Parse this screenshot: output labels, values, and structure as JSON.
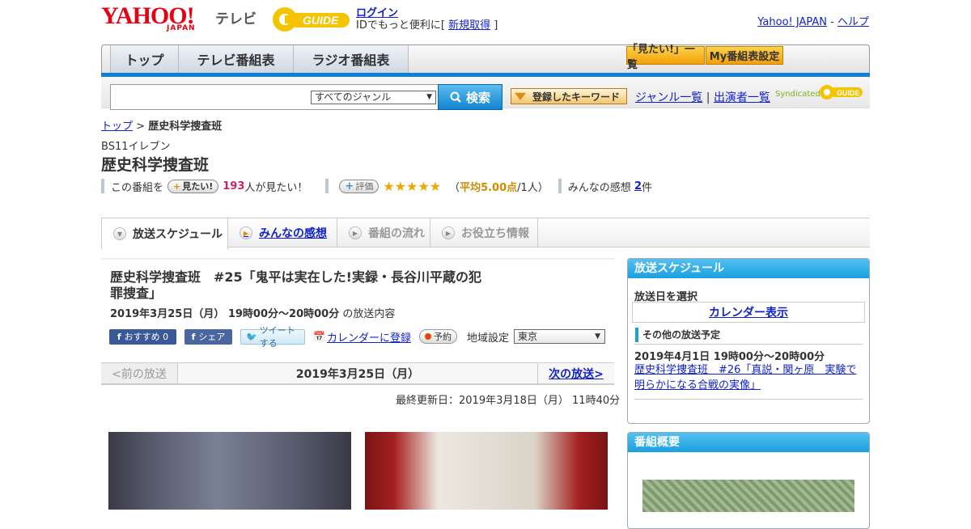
{
  "header": {
    "yahoo_logo": "YAHOO!",
    "japan": "JAPAN",
    "tv": "テレビ",
    "gguide_logo": "GUIDE",
    "login": "ログイン",
    "id_text_prefix": "IDでもっと便利に[",
    "signup": "新規取得",
    "id_text_suffix": "]",
    "yahoo_japan_link": "Yahoo! JAPAN",
    "dash": " - ",
    "help_link": "ヘルプ"
  },
  "nav": {
    "tabs": [
      "トップ",
      "テレビ番組表",
      "ラジオ番組表"
    ],
    "want_list": "「見たい!」一覧",
    "my_schedule": "My番組表設定"
  },
  "search": {
    "genre": "すべてのジャンル",
    "button": "検索",
    "keyword_button": "登録したキーワード",
    "genre_list": "ジャンル一覧",
    "divider": "|",
    "cast_list": "出演者一覧",
    "syndicated": "Syndicated"
  },
  "breadcrumb": {
    "top": "トップ",
    "sep": ">",
    "current": "歴史科学捜査班"
  },
  "program": {
    "channel": "BS11イレブン",
    "title": "歴史科学捜査班",
    "want_prefix": "この番組を",
    "want_button": "見たい!",
    "want_count": "193",
    "want_suffix": "人が見たい！",
    "rating_button": "評価",
    "stars": "★★★★★",
    "avg_open": "（",
    "avg": "平均5.00点",
    "avg_close": "/1人）",
    "reviews_label": "みんなの感想",
    "reviews_count": "2",
    "reviews_unit": "件"
  },
  "tabs": [
    "放送スケジュール",
    "みんなの感想",
    "番組の流れ",
    "お役立ち情報"
  ],
  "episode": {
    "title": "歴史科学捜査班　#25「鬼平は実在した!実録・長谷川平蔵の犯罪捜査」",
    "date": "2019年3月25日（月） 19時00分～20時00分",
    "date_suffix": " の放送内容",
    "recommend": "おすすめ 0",
    "share": "シェア",
    "tweet": "ツイートする",
    "calendar": "カレンダーに登録",
    "reserve": "予約",
    "region_label": "地域設定",
    "region": "東京"
  },
  "pager": {
    "prev": "<前の放送",
    "current": "2019年3月25日（月）",
    "next": "次の放送>"
  },
  "updated": "最終更新日：2019年3月18日（月） 11時40分",
  "sidebar": {
    "schedule_title": "放送スケジュール",
    "select_date": "放送日を選択",
    "calendar": "カレンダー表示",
    "other_title": "その他の放送予定",
    "other_date": "2019年4月1日 19時00分～20時00分",
    "other_link": "歴史科学捜査班　#26「真説・関ヶ原　実験で明らかになる合戦の実像」",
    "overview_title": "番組概要"
  }
}
